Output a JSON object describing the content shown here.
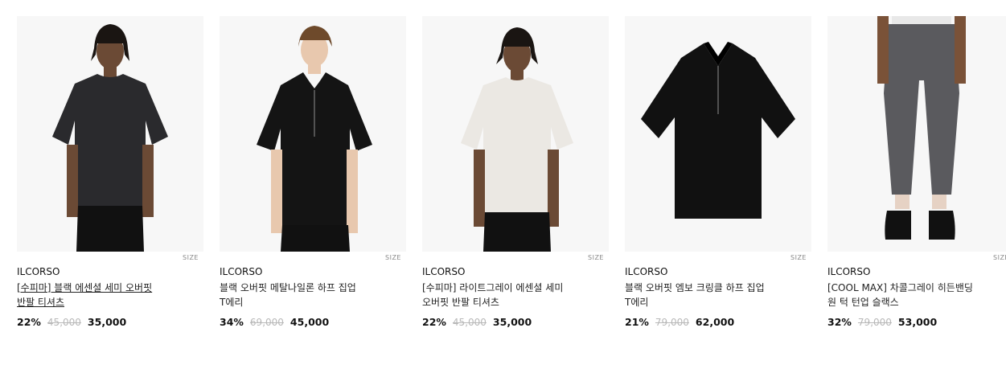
{
  "products": [
    {
      "brand": "ILCORSO",
      "name_line1": "[수피마] 블랙 에센셜 세미 오버핏",
      "name_line2": "반팔 티셔츠",
      "size_label": "SIZE",
      "discount": "22%",
      "original_price": "45,000",
      "sale_price": "35,000",
      "image": "man-in-dark-charcoal-oversized-tshirt",
      "garment_color": "#2a2a2d"
    },
    {
      "brand": "ILCORSO",
      "name_line1": "블랙 오버핏 메탈나일론 하프 집업",
      "name_line2": "T에리",
      "size_label": "SIZE",
      "discount": "34%",
      "original_price": "69,000",
      "sale_price": "45,000",
      "image": "man-in-black-half-zip-collar-shirt",
      "garment_color": "#141414"
    },
    {
      "brand": "ILCORSO",
      "name_line1": "[수피마] 라이트그레이 에센셜 세미",
      "name_line2": "오버핏 반팔 티셔츠",
      "size_label": "SIZE",
      "discount": "22%",
      "original_price": "45,000",
      "sale_price": "35,000",
      "image": "man-in-light-gray-tshirt",
      "garment_color": "#ebe8e3"
    },
    {
      "brand": "ILCORSO",
      "name_line1": "블랙 오버핏 엠보 크링클 하프 집업",
      "name_line2": "T에리",
      "size_label": "SIZE",
      "discount": "21%",
      "original_price": "79,000",
      "sale_price": "62,000",
      "image": "black-half-zip-collar-shirt-flat",
      "garment_color": "#111111"
    },
    {
      "brand": "ILCORSO",
      "name_line1": "[COOL MAX] 차콜그레이 히든밴딩",
      "name_line2": "원 턱 턴업 슬랙스",
      "size_label": "SIZE",
      "discount": "32%",
      "original_price": "79,000",
      "sale_price": "53,000",
      "image": "charcoal-gray-cropped-slacks-with-black-shoes",
      "garment_color": "#5a5a5e"
    }
  ]
}
